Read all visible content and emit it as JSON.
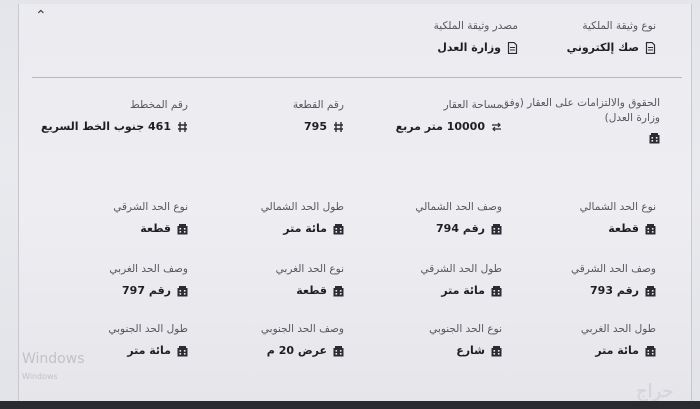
{
  "header": {
    "deed_type": {
      "label": "نوع وثيقة الملكية",
      "value": "صك إلكتروني",
      "icon": "document-icon"
    },
    "deed_source": {
      "label": "مصدر وثيقة الملكية",
      "value": "وزارة العدل",
      "icon": "document-icon"
    }
  },
  "rights": {
    "label": "الحقوق والالتزامات على العقار (وفق وزارة العدل)",
    "icon": "building-icon"
  },
  "property": {
    "area": {
      "label": "مساحة العقار",
      "value": "10000 متر مربع",
      "icon": "arrows-icon"
    },
    "parcel_number": {
      "label": "رقم القطعة",
      "value": "795",
      "icon": "grid-icon"
    },
    "plan_number": {
      "label": "رقم المخطط",
      "value": "461 جنوب الخط السريع",
      "icon": "grid-icon"
    }
  },
  "boundaries": {
    "north_type": {
      "label": "نوع الحد الشمالي",
      "value": "قطعة"
    },
    "north_desc": {
      "label": "وصف الحد الشمالي",
      "value": "رقم 794"
    },
    "north_length": {
      "label": "طول الحد الشمالي",
      "value": "مائة متر"
    },
    "east_type": {
      "label": "نوع الحد الشرقي",
      "value": "قطعة"
    },
    "east_desc": {
      "label": "وصف الحد الشرقي",
      "value": "رقم 793"
    },
    "east_length": {
      "label": "طول الحد الشرقي",
      "value": "مائة متر"
    },
    "west_type": {
      "label": "نوع الحد الغربي",
      "value": "قطعة"
    },
    "west_desc": {
      "label": "وصف الحد الغربي",
      "value": "رقم 797"
    },
    "west_length": {
      "label": "طول الحد الغربي",
      "value": "مائة متر"
    },
    "south_type": {
      "label": "نوع الحد الجنوبي",
      "value": "شارع"
    },
    "south_desc": {
      "label": "وصف الحد الجنوبي",
      "value": "عرض 20 م"
    },
    "south_length": {
      "label": "طول الحد الجنوبي",
      "value": "مائة متر"
    },
    "icon": "building-icon"
  },
  "watermark": {
    "title": "Windows",
    "subtitle": "Windows"
  },
  "logo": "حراج",
  "colors": {
    "text": "#1e1f24",
    "label": "#55575e",
    "background": "#ececf0"
  }
}
